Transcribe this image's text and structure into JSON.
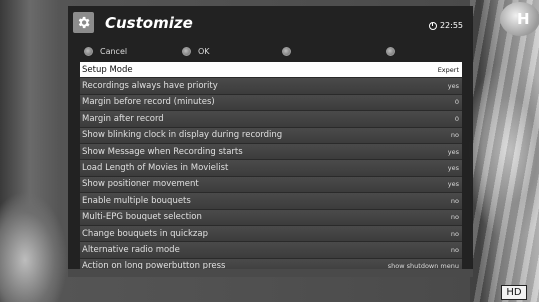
{
  "header": {
    "title": "Customize",
    "clock": "22:55"
  },
  "buttons": [
    {
      "label": "Cancel"
    },
    {
      "label": "OK"
    },
    {
      "label": ""
    },
    {
      "label": ""
    }
  ],
  "settings": [
    {
      "label": "Setup Mode",
      "value": "Expert"
    },
    {
      "label": "Recordings always have priority",
      "value": "yes"
    },
    {
      "label": "Margin before record (minutes)",
      "value": "0"
    },
    {
      "label": "Margin after record",
      "value": "0"
    },
    {
      "label": "Show blinking clock in display during recording",
      "value": "no"
    },
    {
      "label": "Show Message when Recording starts",
      "value": "yes"
    },
    {
      "label": "Load Length of Movies in Movielist",
      "value": "yes"
    },
    {
      "label": "Show positioner movement",
      "value": "yes"
    },
    {
      "label": "Enable multiple bouquets",
      "value": "no"
    },
    {
      "label": "Multi-EPG bouquet selection",
      "value": "no"
    },
    {
      "label": "Change bouquets in quickzap",
      "value": "no"
    },
    {
      "label": "Alternative radio mode",
      "value": "no"
    },
    {
      "label": "Action on long powerbutton press",
      "value": "show shutdown menu"
    }
  ],
  "overlay": {
    "channel_logo_text": "H",
    "hd_badge": "HD"
  },
  "colors": {
    "panel_bg": "#202020",
    "row_bg": "#444444",
    "selected_bg": "#ffffff",
    "text": "#e0e0e0"
  }
}
